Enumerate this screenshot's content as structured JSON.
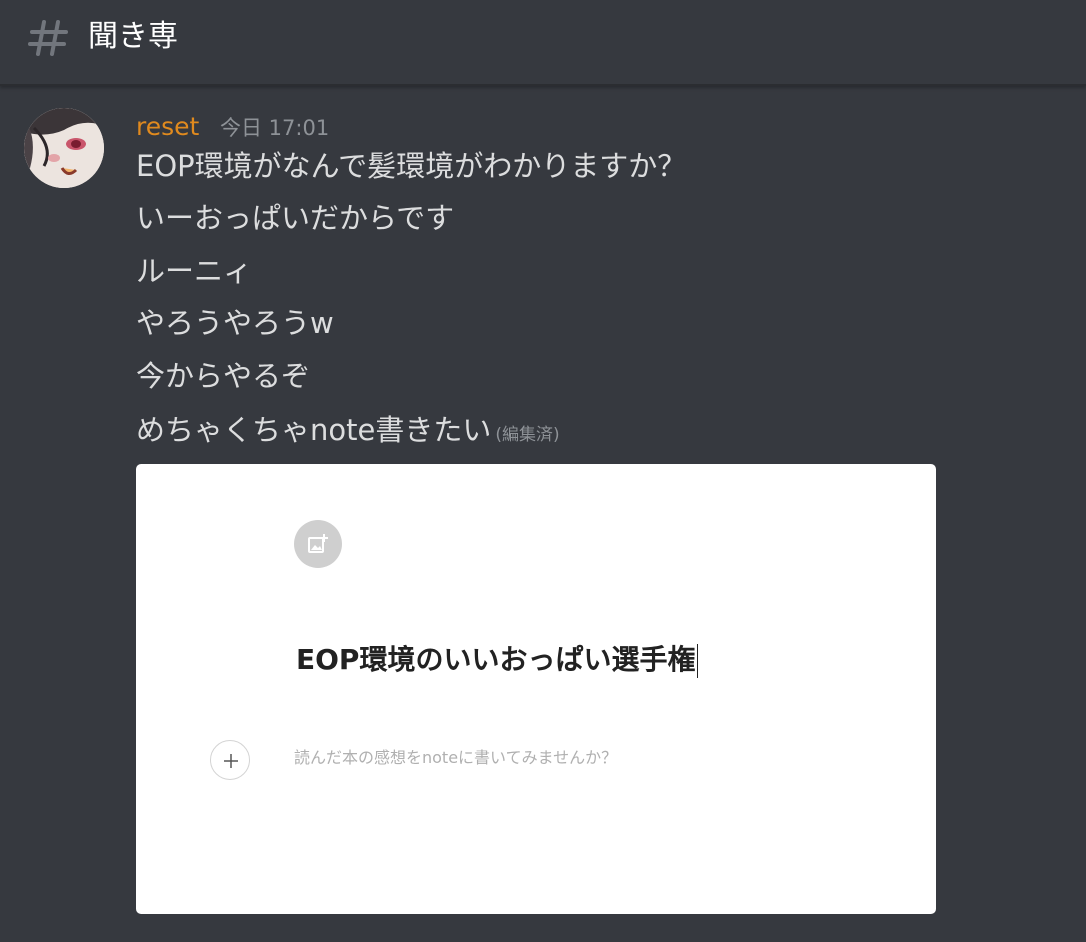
{
  "channel": {
    "name": "聞き専"
  },
  "message": {
    "username": "reset",
    "timestamp": "今日 17:01",
    "lines": [
      "EOP環境がなんで髪環境がわかりますか？",
      "いーおっぱいだからです",
      "ルーニィ",
      "やろうやろうw",
      "今からやるぞ",
      "めちゃくちゃnote書きたい"
    ],
    "edited_label": "(編集済)"
  },
  "embed": {
    "title": "EOP環境のいいおっぱい選手権",
    "body_placeholder": "読んだ本の感想をnoteに書いてみませんか？"
  },
  "colors": {
    "background": "#36393f",
    "username": "#e08a1e",
    "text": "#dcddde",
    "muted": "#8e9297"
  },
  "icons": {
    "channel": "hash-icon",
    "image": "add-image-icon",
    "plus": "plus-icon"
  }
}
